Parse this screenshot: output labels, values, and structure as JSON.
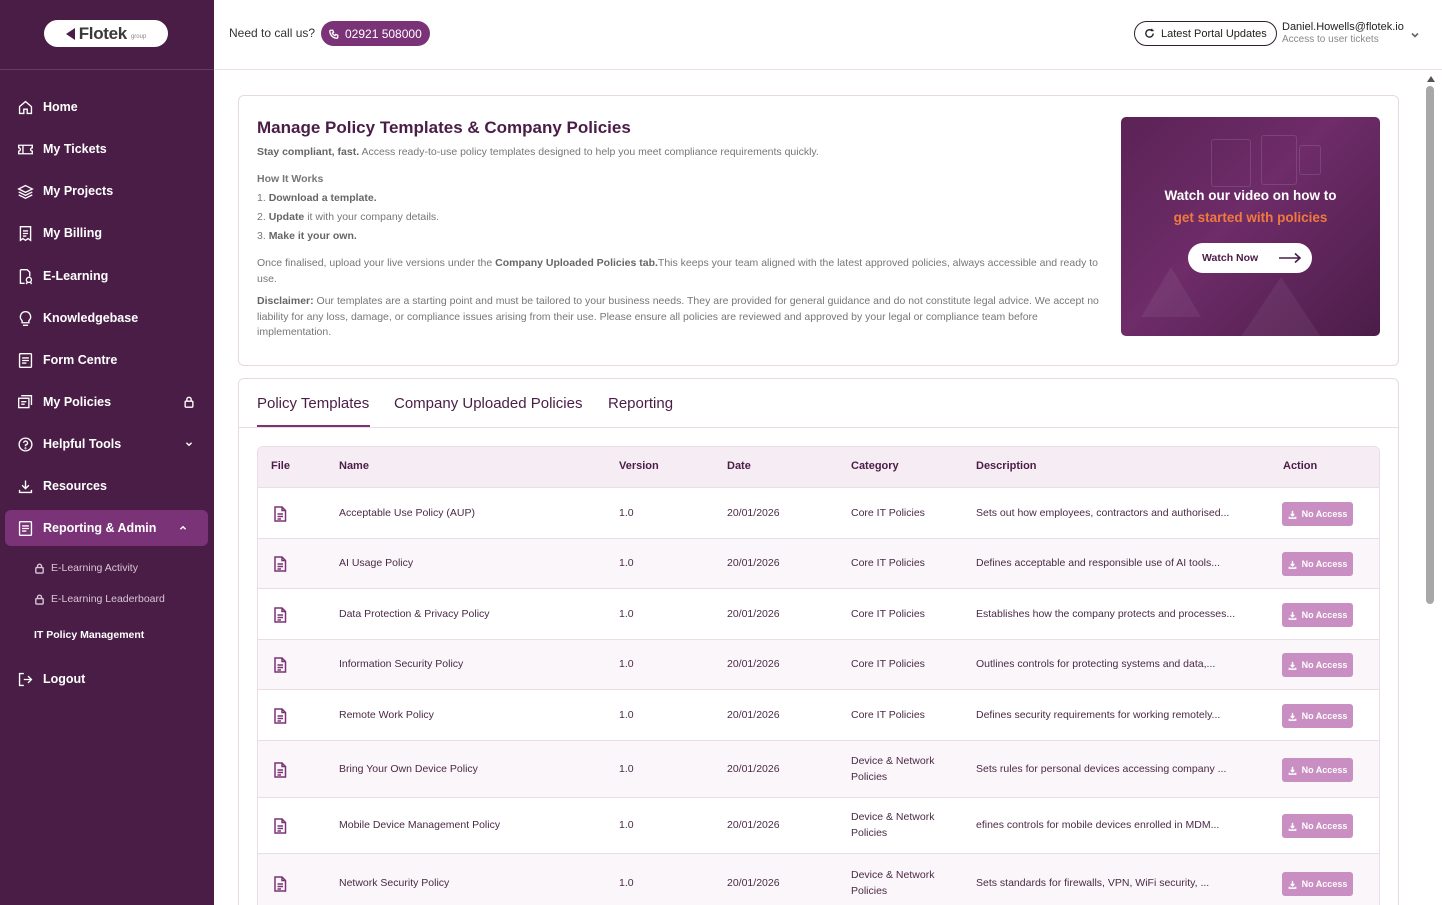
{
  "brand": {
    "logo_text": "Flotek",
    "logo_sub": "group"
  },
  "topbar": {
    "call_label": "Need to call us?",
    "phone": "02921 508000",
    "updates_label": "Latest Portal Updates",
    "user_email": "Daniel.Howells@flotek.io",
    "user_sub": "Access to user tickets"
  },
  "sidebar": {
    "items": [
      {
        "label": "Home"
      },
      {
        "label": "My Tickets"
      },
      {
        "label": "My Projects"
      },
      {
        "label": "My Billing"
      },
      {
        "label": "E-Learning"
      },
      {
        "label": "Knowledgebase"
      },
      {
        "label": "Form Centre"
      },
      {
        "label": "My Policies"
      },
      {
        "label": "Helpful Tools"
      },
      {
        "label": "Resources"
      },
      {
        "label": "Reporting & Admin"
      }
    ],
    "sub_items": [
      {
        "label": "E-Learning Activity"
      },
      {
        "label": "E-Learning Leaderboard"
      },
      {
        "label": "IT Policy Management"
      }
    ],
    "logout": "Logout"
  },
  "intro": {
    "title": "Manage Policy Templates & Company Policies",
    "lead_bold": "Stay compliant, fast.",
    "lead_rest": " Access ready-to-use policy templates designed to help you meet compliance requirements quickly.",
    "how_title": "How It Works",
    "step1_num": "1. ",
    "step1_bold": "Download a template.",
    "step2_num": "2. ",
    "step2_bold": "Update",
    "step2_rest": " it with your company details.",
    "step3_num": "3. ",
    "step3_bold": "Make it your own.",
    "upload_pre": "Once finalised, upload your live versions under the ",
    "upload_bold": "Company Uploaded Policies tab.",
    "upload_rest": "This keeps your team aligned with the latest approved policies, always accessible and ready to use.",
    "disclaimer_bold": "Disclaimer:",
    "disclaimer_rest": " Our templates are a starting point and must be tailored to your business needs. They are provided for general guidance and do not constitute legal advice. We accept no liability for any loss, damage, or compliance issues arising from their use. Please ensure all policies are reviewed and approved by your legal or compliance team before implementation.",
    "video_line1": "Watch our video on how to",
    "video_line2": "get started with policies",
    "watch_label": "Watch Now"
  },
  "tabs": [
    {
      "label": "Policy Templates"
    },
    {
      "label": "Company Uploaded Policies"
    },
    {
      "label": "Reporting"
    }
  ],
  "table": {
    "headers": {
      "file": "File",
      "name": "Name",
      "version": "Version",
      "date": "Date",
      "category": "Category",
      "description": "Description",
      "action": "Action"
    },
    "action_label": "No Access",
    "rows": [
      {
        "name": "Acceptable Use Policy (AUP)",
        "version": "1.0",
        "date": "20/01/2026",
        "category": "Core IT Policies",
        "description": "Sets out how employees, contractors and authorised..."
      },
      {
        "name": "AI Usage Policy",
        "version": "1.0",
        "date": "20/01/2026",
        "category": "Core IT Policies",
        "description": "Defines acceptable and responsible use of AI tools..."
      },
      {
        "name": "Data Protection & Privacy Policy",
        "version": "1.0",
        "date": "20/01/2026",
        "category": "Core IT Policies",
        "description": "Establishes how the company protects and processes..."
      },
      {
        "name": "Information Security Policy",
        "version": "1.0",
        "date": "20/01/2026",
        "category": "Core IT Policies",
        "description": "Outlines controls for protecting systems and data,..."
      },
      {
        "name": "Remote Work Policy",
        "version": "1.0",
        "date": "20/01/2026",
        "category": "Core IT Policies",
        "description": "Defines security requirements for working remotely..."
      },
      {
        "name": "Bring Your Own Device Policy",
        "version": "1.0",
        "date": "20/01/2026",
        "category": "Device & Network Policies",
        "description": "Sets rules for personal devices accessing company ..."
      },
      {
        "name": "Mobile Device Management Policy",
        "version": "1.0",
        "date": "20/01/2026",
        "category": "Device & Network Policies",
        "description": "efines controls for mobile devices enrolled in MDM..."
      },
      {
        "name": "Network Security Policy",
        "version": "1.0",
        "date": "20/01/2026",
        "category": "Device & Network Policies",
        "description": "Sets standards for firewalls, VPN, WiFi security, ..."
      }
    ]
  },
  "colors": {
    "sidebar": "#4a1d47",
    "accent": "#7b3377",
    "active": "#7b3377",
    "no_access": "#c98fc2",
    "video_highlight": "#f07a3c"
  }
}
